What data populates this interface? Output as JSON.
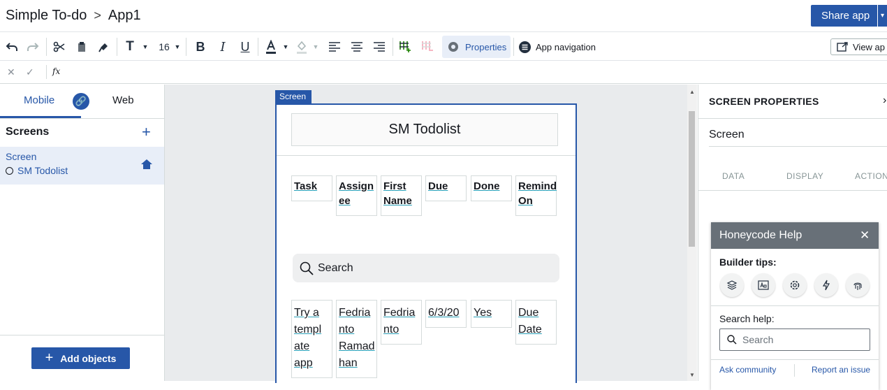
{
  "header": {
    "app_name": "Simple To-do",
    "separator": ">",
    "page": "App1",
    "share_label": "Share app"
  },
  "toolbar": {
    "font_size": "16",
    "properties_label": "Properties",
    "app_nav_label": "App navigation",
    "view_label": "View ap"
  },
  "formula": {
    "fx": "fx"
  },
  "left": {
    "tab_mobile": "Mobile",
    "tab_web": "Web",
    "screens_title": "Screens",
    "screen_name": "Screen",
    "screen_sub": "SM Todolist",
    "add_objects": "Add objects"
  },
  "canvas": {
    "screen_tag": "Screen",
    "title": "SM Todolist",
    "headers": [
      {
        "lines": [
          "Task"
        ]
      },
      {
        "lines": [
          "Assign",
          "ee"
        ]
      },
      {
        "lines": [
          "First",
          "Name"
        ]
      },
      {
        "lines": [
          "Due"
        ]
      },
      {
        "lines": [
          "Done"
        ]
      },
      {
        "lines": [
          "Remind",
          "On"
        ]
      }
    ],
    "search_placeholder": "Search",
    "row": [
      {
        "lines": [
          "Try a",
          "templ",
          "ate",
          "app"
        ]
      },
      {
        "lines": [
          "Fedria",
          "nto",
          "Ramad",
          "han"
        ]
      },
      {
        "lines": [
          "Fedria",
          "nto"
        ]
      },
      {
        "lines": [
          "6/3/20"
        ]
      },
      {
        "lines": [
          "Yes"
        ]
      },
      {
        "lines": [
          "Due",
          "Date"
        ]
      }
    ]
  },
  "right": {
    "title": "SCREEN PROPERTIES",
    "close": "›",
    "screen_name": "Screen",
    "tabs": [
      "DATA",
      "DISPLAY",
      "ACTIONS"
    ]
  },
  "help": {
    "title": "Honeycode Help",
    "close": "✕",
    "builder_tips": "Builder tips:",
    "search_help": "Search help:",
    "search_placeholder": "Search",
    "ask": "Ask community",
    "report": "Report an issue",
    "tip_icons": [
      "layers-icon",
      "text-icon",
      "gear-icon",
      "lightning-icon",
      "fingerprint-icon"
    ]
  },
  "colors": {
    "accent": "#2757a8",
    "help_header": "#687078",
    "selected_bg": "#e8eef8"
  }
}
